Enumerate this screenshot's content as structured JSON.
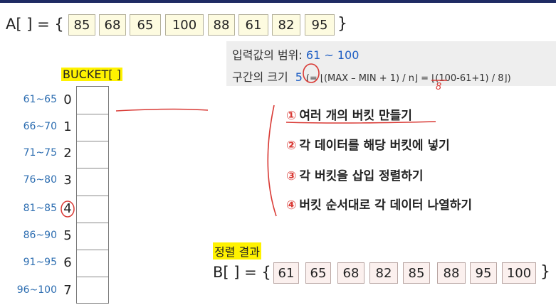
{
  "array_a": {
    "label": "A[ ] = {",
    "close": "}",
    "values": [
      "85",
      "68",
      "65",
      "100",
      "88",
      "61",
      "82",
      "95"
    ]
  },
  "info": {
    "range_label": "입력값의 범위: ",
    "range_value": "61 ~ 100",
    "size_label": "구간의 크기 ",
    "size_value": "5",
    "formula": "(= ⌊(MAX – MIN + 1) / n⌋ = ⌊(100-61+1) / 8⌋)",
    "handwritten_n": "8"
  },
  "bucket": {
    "title": "BUCKET[ ]",
    "ranges": [
      "61~65",
      "66~70",
      "71~75",
      "76~80",
      "81~85",
      "86~90",
      "91~95",
      "96~100"
    ],
    "indices": [
      "0",
      "1",
      "2",
      "3",
      "4",
      "5",
      "6",
      "7"
    ]
  },
  "steps": [
    {
      "num": "①",
      "text": "여러 개의 버킷 만들기"
    },
    {
      "num": "②",
      "text": "각 데이터를 해당 버킷에 넣기"
    },
    {
      "num": "③",
      "text": "각 버킷을 삽입 정렬하기"
    },
    {
      "num": "④",
      "text": "버킷 순서대로 각 데이터 나열하기"
    }
  ],
  "result": {
    "title": "정렬 결과",
    "label": "B[ ] = {",
    "close": "}",
    "values": [
      "61",
      "65",
      "68",
      "82",
      "85",
      "88",
      "95",
      "100"
    ]
  },
  "colors": {
    "highlight": "#fff200",
    "annotation": "#d93a35",
    "range_text": "#2b6cb0",
    "header_bar": "#1e2b63"
  }
}
